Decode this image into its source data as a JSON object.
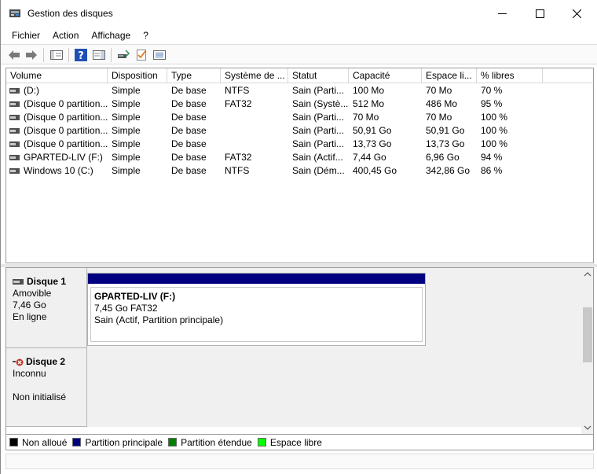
{
  "window": {
    "title": "Gestion des disques",
    "controls": {
      "minimize": "minimize-icon",
      "maximize": "maximize-icon",
      "close": "close-icon"
    }
  },
  "menu": [
    "Fichier",
    "Action",
    "Affichage",
    "?"
  ],
  "toolbar": [
    "back-arrow-icon",
    "forward-arrow-icon",
    "console-tree-icon",
    "help-icon",
    "properties-panel-icon",
    "connect-disk-icon",
    "check-properties-icon",
    "list-view-icon"
  ],
  "volume_table": {
    "columns": [
      "Volume",
      "Disposition",
      "Type",
      "Système de ...",
      "Statut",
      "Capacité",
      "Espace li...",
      "% libres"
    ],
    "rows": [
      [
        "(D:)",
        "Simple",
        "De base",
        "NTFS",
        "Sain (Parti...",
        "100 Mo",
        "70 Mo",
        "70 %"
      ],
      [
        "(Disque 0 partition...",
        "Simple",
        "De base",
        "FAT32",
        "Sain (Systè...",
        "512 Mo",
        "486 Mo",
        "95 %"
      ],
      [
        "(Disque 0 partition...",
        "Simple",
        "De base",
        "",
        "Sain (Parti...",
        "70 Mo",
        "70 Mo",
        "100 %"
      ],
      [
        "(Disque 0 partition...",
        "Simple",
        "De base",
        "",
        "Sain (Parti...",
        "50,91 Go",
        "50,91 Go",
        "100 %"
      ],
      [
        "(Disque 0 partition...",
        "Simple",
        "De base",
        "",
        "Sain (Parti...",
        "13,73 Go",
        "13,73 Go",
        "100 %"
      ],
      [
        "GPARTED-LIV (F:)",
        "Simple",
        "De base",
        "FAT32",
        "Sain (Actif...",
        "7,44 Go",
        "6,96 Go",
        "94 %"
      ],
      [
        "Windows 10 (C:)",
        "Simple",
        "De base",
        "NTFS",
        "Sain (Dém...",
        "400,45 Go",
        "342,86 Go",
        "86 %"
      ]
    ]
  },
  "disks": [
    {
      "name": "Disque 1",
      "kind": "Amovible",
      "size": "7,46 Go",
      "state": "En ligne",
      "icon": "removable-disk-icon",
      "partition": {
        "title": "GPARTED-LIV  (F:)",
        "size_fs": "7,45 Go FAT32",
        "status": "Sain (Actif, Partition principale)",
        "color": "#000080"
      }
    },
    {
      "name": "Disque 2",
      "kind": "Inconnu",
      "state": "Non initialisé",
      "icon": "uninitialized-disk-icon"
    }
  ],
  "legend": [
    {
      "label": "Non alloué",
      "color": "#000000"
    },
    {
      "label": "Partition principale",
      "color": "#000080"
    },
    {
      "label": "Partition étendue",
      "color": "#008000"
    },
    {
      "label": "Espace libre",
      "color": "#00ff00"
    }
  ]
}
